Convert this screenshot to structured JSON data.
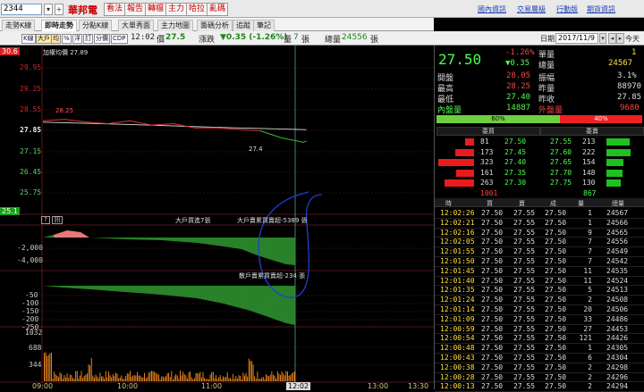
{
  "toolbar": {
    "code": "2344",
    "stock_name": "華邦電",
    "buttons": [
      "看法",
      "報告",
      "轉檔",
      "主力",
      "哈拉",
      "亂碼"
    ],
    "links": [
      "國內資訊",
      "交易層級",
      "行動版",
      "期貨資訊"
    ]
  },
  "tabs": [
    "走勢K線",
    "即時走勢",
    "分點K線",
    "大單秀面",
    "主力地圖",
    "籌碼分析",
    "追蹤",
    "筆記"
  ],
  "chart_toolbar": {
    "buttons": [
      "K線",
      "大戶",
      "均",
      "%",
      "洋",
      "訂",
      "分價",
      "CDP"
    ],
    "time": "12:02",
    "price_label": "價",
    "price": "27.5",
    "change_label": "漲跌",
    "change": "▼0.35 (-1.26%)",
    "vol_label": "量",
    "vol": "7",
    "vol_unit": "張",
    "total_label": "總量",
    "total": "24556",
    "total_unit": "張"
  },
  "chart_data": {
    "type": "line",
    "title": "",
    "upper_limit": "30.6",
    "lower_limit": "25.1",
    "legend_ma": "加權均價 27.89",
    "price_ticks": [
      "29.95",
      "29.25",
      "28.55",
      "27.85",
      "27.15",
      "26.45",
      "25.75"
    ],
    "ylim": [
      25.1,
      30.6
    ],
    "annot_high": "28.25",
    "annot_low": "27.4",
    "big_order_labels": [
      "大戶買進7張",
      "大戶賣累買賣超-5389 張"
    ],
    "small_order_labels": [
      "散戶賣累買賣超-234 張"
    ],
    "sub_buttons": [
      "?",
      "訊"
    ],
    "mid1_ticks": [
      "-2,000",
      "-4,000"
    ],
    "mid2_ticks": [
      "-50",
      "-100",
      "-150",
      "-200",
      "-250"
    ],
    "vol_ticks": [
      "1032",
      "688",
      "344"
    ],
    "x_labels": [
      "09:00",
      "10:00",
      "11:00",
      "12:02",
      "13:00",
      "13:30"
    ],
    "price_series": {
      "x": [
        "09:00",
        "09:15",
        "09:30",
        "09:45",
        "10:00",
        "10:15",
        "10:30",
        "10:45",
        "11:00",
        "11:15",
        "11:30",
        "11:45",
        "12:00",
        "12:02"
      ],
      "y": [
        28.2,
        28.25,
        28.15,
        28.1,
        28.2,
        28.05,
        28.1,
        27.95,
        27.95,
        27.9,
        27.85,
        27.6,
        27.45,
        27.5
      ]
    },
    "ma_series": {
      "x": [
        "09:00",
        "10:00",
        "11:00",
        "12:02"
      ],
      "y": [
        28.15,
        28.07,
        27.97,
        27.89
      ]
    }
  },
  "quote": {
    "date_label": "日期:",
    "date": "2017/11/9",
    "today_btn": "今天",
    "price": "27.50",
    "pct": "-1.26%",
    "chg": "▼0.35",
    "single_label": "單量",
    "single": "1",
    "total_label": "總量",
    "total": "24567",
    "rows": [
      {
        "l1": "開盤",
        "v1": "28.05",
        "l2": "振幅",
        "v2": "3.1%",
        "c1": "#ff4040"
      },
      {
        "l1": "最高",
        "v1": "28.25",
        "l2": "昨量",
        "v2": "88970",
        "c1": "#ff4040"
      },
      {
        "l1": "最低",
        "v1": "27.40",
        "l2": "昨收",
        "v2": "27.85",
        "c1": "#4cff4c"
      }
    ],
    "inner_label": "內盤量",
    "inner": "14887",
    "outer_label": "外盤量",
    "outer": "9680",
    "ratio_green": "60%",
    "ratio_red": "40%",
    "bid_hdr": "委買",
    "ask_hdr": "委賣",
    "book": [
      {
        "bv": "81",
        "bp": "27.50",
        "ap": "27.55",
        "av": "213"
      },
      {
        "bv": "173",
        "bp": "27.45",
        "ap": "27.60",
        "av": "222"
      },
      {
        "bv": "323",
        "bp": "27.40",
        "ap": "27.65",
        "av": "154"
      },
      {
        "bv": "161",
        "bp": "27.35",
        "ap": "27.70",
        "av": "148"
      },
      {
        "bv": "263",
        "bp": "27.30",
        "ap": "27.75",
        "av": "130"
      }
    ],
    "sum_bid": "1001",
    "sum_ask": "867",
    "tick_hdr": [
      "時",
      "買",
      "賣",
      "成",
      "量",
      "總量"
    ],
    "ticks": [
      [
        "12:02:26",
        "27.50",
        "27.55",
        "27.50",
        "1",
        "24567"
      ],
      [
        "12:02:21",
        "27.50",
        "27.55",
        "27.50",
        "1",
        "24566"
      ],
      [
        "12:02:16",
        "27.50",
        "27.55",
        "27.50",
        "9",
        "24565"
      ],
      [
        "12:02:05",
        "27.50",
        "27.55",
        "27.50",
        "7",
        "24556"
      ],
      [
        "12:01:55",
        "27.50",
        "27.55",
        "27.50",
        "7",
        "24549"
      ],
      [
        "12:01:50",
        "27.50",
        "27.55",
        "27.50",
        "7",
        "24542"
      ],
      [
        "12:01:45",
        "27.50",
        "27.55",
        "27.50",
        "11",
        "24535"
      ],
      [
        "12:01:40",
        "27.50",
        "27.55",
        "27.50",
        "11",
        "24524"
      ],
      [
        "12:01:35",
        "27.50",
        "27.55",
        "27.50",
        "5",
        "24513"
      ],
      [
        "12:01:24",
        "27.50",
        "27.55",
        "27.50",
        "2",
        "24508"
      ],
      [
        "12:01:14",
        "27.50",
        "27.55",
        "27.50",
        "20",
        "24506"
      ],
      [
        "12:01:09",
        "27.50",
        "27.55",
        "27.50",
        "33",
        "24486"
      ],
      [
        "12:00:59",
        "27.50",
        "27.55",
        "27.50",
        "27",
        "24453"
      ],
      [
        "12:00:54",
        "27.50",
        "27.55",
        "27.50",
        "121",
        "24426"
      ],
      [
        "12:00:48",
        "27.50",
        "27.55",
        "27.50",
        "1",
        "24305"
      ],
      [
        "12:00:43",
        "27.50",
        "27.55",
        "27.50",
        "6",
        "24304"
      ],
      [
        "12:00:38",
        "27.50",
        "27.55",
        "27.50",
        "2",
        "24298"
      ],
      [
        "12:00:28",
        "27.50",
        "27.55",
        "27.50",
        "2",
        "24296"
      ],
      [
        "12:00:13",
        "27.50",
        "27.55",
        "27.50",
        "2",
        "24294"
      ]
    ]
  }
}
